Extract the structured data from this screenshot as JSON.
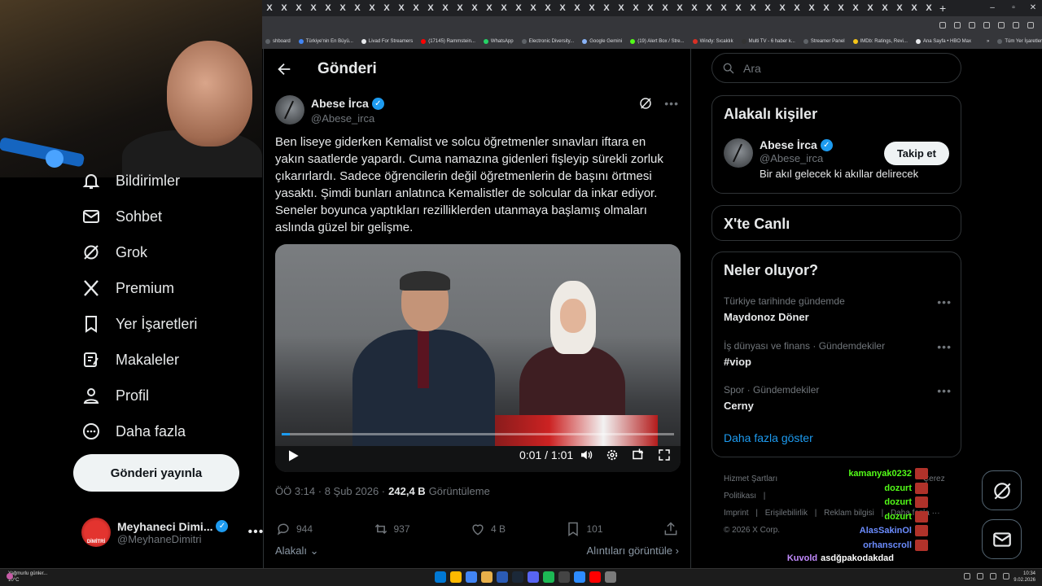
{
  "browser": {
    "tab_glyph": "X",
    "tab_count": 46,
    "new_tab": "+",
    "window_controls": [
      "–",
      "▫",
      "✕"
    ],
    "bookmarks": [
      {
        "label": "shboard",
        "color": "#5f6368"
      },
      {
        "label": "Türkiye'nin En Büyü...",
        "color": "#4285f4"
      },
      {
        "label": "Livad For Streamers",
        "color": "#e8eaed"
      },
      {
        "label": "(17145) Rammstein...",
        "color": "#ff0000"
      },
      {
        "label": "WhatsApp",
        "color": "#25d366"
      },
      {
        "label": "Electronic Diversity...",
        "color": "#5f6368"
      },
      {
        "label": "Google Gemini",
        "color": "#8ab4f8"
      },
      {
        "label": "(19) Alert Box / Stre...",
        "color": "#53fc18"
      },
      {
        "label": "Windy: Sıcaklık",
        "color": "#d93025"
      },
      {
        "label": "Multi TV - 6 haber k...",
        "color": "#333333"
      },
      {
        "label": "Streamer Panel",
        "color": "#5f6368"
      },
      {
        "label": "IMDb: Ratings, Revi...",
        "color": "#f5c518"
      },
      {
        "label": "Ana Sayfa • HBO Max",
        "color": "#e8eaed"
      },
      {
        "label": "»",
        "color": "#35363a"
      },
      {
        "label": "Tüm Yer İşaretleri",
        "color": "#5f6368"
      }
    ]
  },
  "nav": {
    "items": [
      {
        "label": "Bildirimler",
        "icon": "bell-icon"
      },
      {
        "label": "Sohbet",
        "icon": "envelope-icon"
      },
      {
        "label": "Grok",
        "icon": "grok-icon"
      },
      {
        "label": "Premium",
        "icon": "x-logo-icon"
      },
      {
        "label": "Yer İşaretleri",
        "icon": "bookmark-icon"
      },
      {
        "label": "Makaleler",
        "icon": "article-icon"
      },
      {
        "label": "Profil",
        "icon": "person-icon"
      },
      {
        "label": "Daha fazla",
        "icon": "more-circle-icon"
      }
    ],
    "post_button": "Gönderi yayınla",
    "account": {
      "name": "Meyhaneci Dimi...",
      "handle": "@MeyhaneDimitri",
      "avatar_text": "DİMİTRİ",
      "more": "•••"
    }
  },
  "main": {
    "title": "Gönderi",
    "post": {
      "author_name": "Abese İrca",
      "author_handle": "@Abese_irca",
      "text": "Ben liseye giderken Kemalist ve solcu öğretmenler sınavları iftara en yakın saatlerde yapardı. Cuma namazına gidenleri fişleyip sürekli zorluk çıkarırlardı. Sadece öğrencilerin değil öğretmenlerin de başını örtmesi yasaktı. Şimdi bunları anlatınca Kemalistler de solcular da inkar ediyor. Seneler boyunca yaptıkları rezilliklerden utanmaya başlamış olmaları aslında güzel bir gelişme.",
      "video": {
        "time": "0:01 / 1:01",
        "progress": 0.02
      },
      "meta_time": "ÖÖ 3:14 · 8 Şub 2026 ·",
      "views": "242,4 B",
      "views_label": "Görüntüleme",
      "actions": {
        "replies": "944",
        "reposts": "937",
        "likes": "4 B",
        "bookmarks": "101"
      },
      "relevant_label": "Alakalı",
      "quotes_label": "Alıntıları görüntüle"
    }
  },
  "right": {
    "search_placeholder": "Ara",
    "related_title": "Alakalı kişiler",
    "related_person": {
      "name": "Abese İrca",
      "handle": "@Abese_irca",
      "bio": "Bir akıl gelecek ki akıllar delirecek",
      "follow": "Takip et"
    },
    "live_title": "X'te Canlı",
    "trends_title": "Neler oluyor?",
    "trends": [
      {
        "context": "Türkiye tarihinde gündemde",
        "name": "Maydonoz Döner"
      },
      {
        "context": "İş dünyası ve finans · Gündemdekiler",
        "name": "#viop"
      },
      {
        "context": "Spor · Gündemdekiler",
        "name": "Cerny"
      }
    ],
    "trend_more": "•••",
    "show_more": "Daha fazla göster",
    "footer": {
      "terms": "Hizmet Şartları",
      "cookies": "Çerez Politikası",
      "separator": "|",
      "imprint": "Imprint",
      "accessibility": "Erişilebilirlik",
      "ads": "Reklam bilgisi",
      "more": "Daha fazla ···",
      "copyright": "© 2026 X Corp."
    }
  },
  "chat": [
    {
      "user": "kamanyak0232",
      "color": "#53fc18",
      "message": ""
    },
    {
      "user": "dozurt",
      "color": "#53fc18",
      "message": ""
    },
    {
      "user": "dozurt",
      "color": "#53fc18",
      "message": ""
    },
    {
      "user": "dozurt",
      "color": "#53fc18",
      "message": ""
    },
    {
      "user": "AlasSakinOl",
      "color": "#6b8cff",
      "message": ""
    },
    {
      "user": "orhanscroll",
      "color": "#6b8cff",
      "message": ""
    },
    {
      "user": "Kuvold",
      "color": "#c38bff",
      "message": "asdğpakodakdad"
    },
    {
      "user": "orhanscroll",
      "color": "#6b8cff",
      "message": ""
    }
  ],
  "taskbar": {
    "weather_text": "Yağmurlu günler...",
    "weather_temp": "10°C",
    "time": "10:34",
    "date": "9.02.2026",
    "apps": [
      "#0078d4",
      "#ffb900",
      "#4285f4",
      "#e8b04a",
      "#2b5bb5",
      "#1b2838",
      "#5865f2",
      "#1db954",
      "#444444",
      "#2d8cff",
      "#ff0000",
      "#7a7a7a"
    ]
  }
}
